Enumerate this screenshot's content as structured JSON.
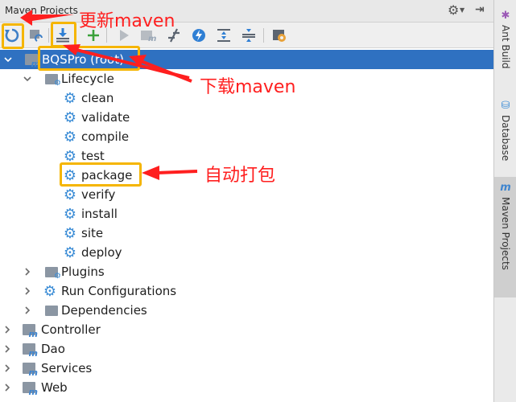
{
  "panel": {
    "title": "Maven Projects"
  },
  "toolbar": {
    "buttons": [
      {
        "name": "reimport-icon"
      },
      {
        "name": "generate-sources-icon"
      },
      {
        "name": "download-icon"
      },
      {
        "name": "add-icon"
      },
      {
        "name": "run-icon"
      },
      {
        "name": "execute-goal-icon"
      },
      {
        "name": "toggle-offline-icon"
      },
      {
        "name": "skip-tests-icon"
      },
      {
        "name": "expand-all-icon"
      },
      {
        "name": "collapse-all-icon"
      },
      {
        "name": "settings-icon"
      }
    ]
  },
  "tree": {
    "root": {
      "label": "BQSPro (root)"
    },
    "lifecycle": {
      "label": "Lifecycle"
    },
    "phases": [
      "clean",
      "validate",
      "compile",
      "test",
      "package",
      "verify",
      "install",
      "site",
      "deploy"
    ],
    "plugins": {
      "label": "Plugins"
    },
    "run_configurations": {
      "label": "Run Configurations"
    },
    "dependencies": {
      "label": "Dependencies"
    },
    "modules": [
      "Controller",
      "Dao",
      "Services",
      "Web"
    ]
  },
  "annotations": {
    "update_maven": "更新maven",
    "download_maven": "下载maven",
    "auto_package": "自动打包"
  },
  "sidebar": {
    "tabs": [
      {
        "label": "Ant Build",
        "icon": "ant-icon"
      },
      {
        "label": "Database",
        "icon": "database-icon"
      },
      {
        "label": "Maven Projects",
        "icon": "maven-icon",
        "active": true
      }
    ]
  },
  "colors": {
    "selection": "#2f71c1",
    "highlight_box": "#f5b500",
    "annotation": "#ff1f1f",
    "gear": "#3c8dd6"
  }
}
